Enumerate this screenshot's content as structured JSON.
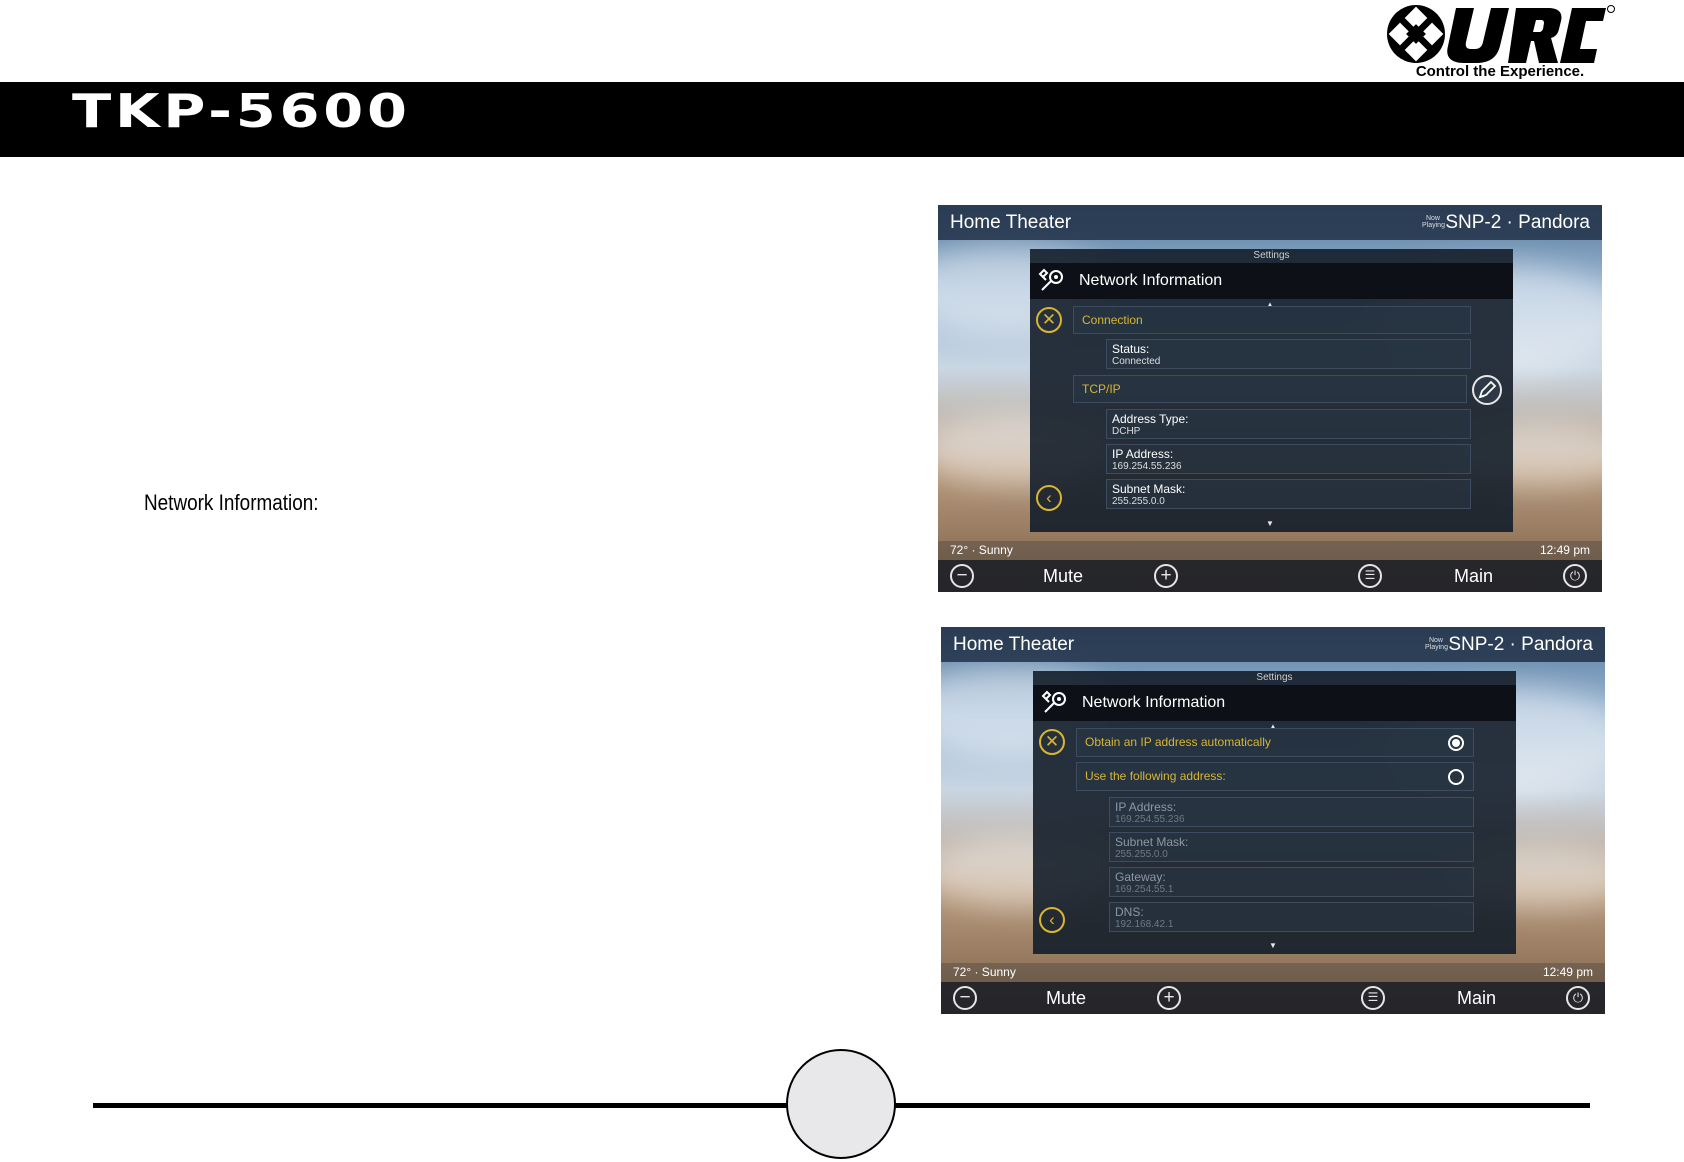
{
  "brand": {
    "logo_text": "URC",
    "tagline": "Control the Experience."
  },
  "header": {
    "model": "TKP-5600"
  },
  "section_label": "Network Information:",
  "screen_common": {
    "room": "Home Theater",
    "now_playing": "Now Playing",
    "source": "SNP-2 · Pandora",
    "settings_caption": "Settings",
    "panel_title": "Network Information",
    "weather": "72° · Sunny",
    "time": "12:49 pm",
    "mute_label": "Mute",
    "main_label": "Main"
  },
  "screen1": {
    "connection_header": "Connection",
    "status": {
      "label": "Status:",
      "value": "Connected"
    },
    "tcpip_header": "TCP/IP",
    "address_type": {
      "label": "Address Type:",
      "value": "DCHP"
    },
    "ip_address": {
      "label": "IP Address:",
      "value": "169.254.55.236"
    },
    "subnet_mask": {
      "label": "Subnet Mask:",
      "value": "255.255.0.0"
    }
  },
  "screen2": {
    "option_auto": "Obtain an IP address automatically",
    "option_manual": "Use the following address:",
    "selected_option": "auto",
    "ip_address": {
      "label": "IP Address:",
      "value": "169.254.55.236"
    },
    "subnet_mask": {
      "label": "Subnet Mask:",
      "value": "255.255.0.0"
    },
    "gateway": {
      "label": "Gateway:",
      "value": "169.254.55.1"
    },
    "dns": {
      "label": "DNS:",
      "value": "192.168.42.1"
    }
  },
  "icons": [
    "urc-logo-icon",
    "tools-icon",
    "close-icon",
    "back-icon",
    "edit-icon",
    "minus-icon",
    "plus-icon",
    "menu-icon",
    "power-icon",
    "scroll-up-icon",
    "scroll-down-icon"
  ]
}
